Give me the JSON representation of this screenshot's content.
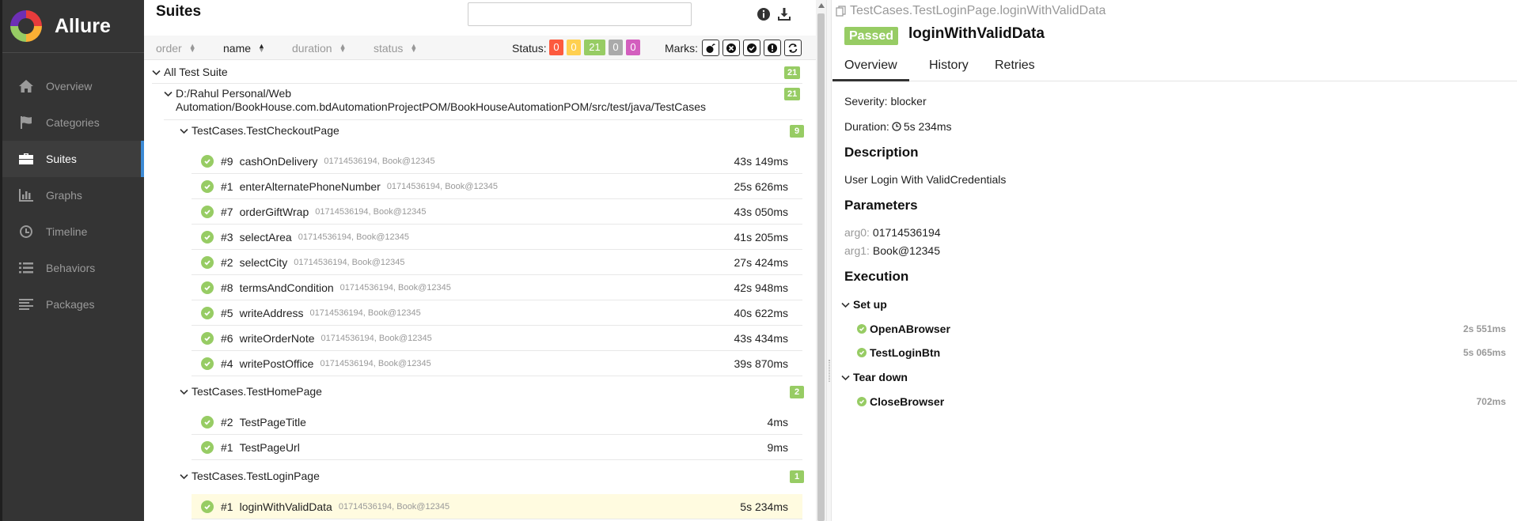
{
  "brand": {
    "name": "Allure"
  },
  "sidebar": {
    "items": [
      {
        "label": "Overview",
        "icon": "home-icon"
      },
      {
        "label": "Categories",
        "icon": "flag-icon"
      },
      {
        "label": "Suites",
        "icon": "briefcase-icon",
        "active": true
      },
      {
        "label": "Graphs",
        "icon": "bar-chart-icon"
      },
      {
        "label": "Timeline",
        "icon": "clock-icon"
      },
      {
        "label": "Behaviors",
        "icon": "list-icon"
      },
      {
        "label": "Packages",
        "icon": "align-left-icon"
      }
    ]
  },
  "suites": {
    "title": "Suites",
    "search_placeholder": "",
    "sort": {
      "order": "order",
      "name": "name",
      "duration": "duration",
      "status": "status"
    },
    "status_label": "Status:",
    "status_counts": [
      {
        "value": "0",
        "color": "#fd5a3e"
      },
      {
        "value": "0",
        "color": "#ffd050"
      },
      {
        "value": "21",
        "color": "#97cc64"
      },
      {
        "value": "0",
        "color": "#aaaaaa"
      },
      {
        "value": "0",
        "color": "#d35ebe"
      }
    ],
    "marks_label": "Marks:",
    "root": {
      "label": "All Test Suite",
      "count": "21"
    },
    "path": {
      "line1": "D:/Rahul Personal/Web",
      "line2": "Automation/BookHouse.com.bdAutomationProjectPOM/BookHouseAutomationPOM/src/test/java/TestCases",
      "count": "21"
    },
    "groups": [
      {
        "name": "TestCases.TestCheckoutPage",
        "count": "9",
        "rows": [
          {
            "num": "#9",
            "name": "cashOnDelivery",
            "params": "01714536194, Book@12345",
            "dur": "43s 149ms"
          },
          {
            "num": "#1",
            "name": "enterAlternatePhoneNumber",
            "params": "01714536194, Book@12345",
            "dur": "25s 626ms"
          },
          {
            "num": "#7",
            "name": "orderGiftWrap",
            "params": "01714536194, Book@12345",
            "dur": "43s 050ms"
          },
          {
            "num": "#3",
            "name": "selectArea",
            "params": "01714536194, Book@12345",
            "dur": "41s 205ms"
          },
          {
            "num": "#2",
            "name": "selectCity",
            "params": "01714536194, Book@12345",
            "dur": "27s 424ms"
          },
          {
            "num": "#8",
            "name": "termsAndCondition",
            "params": "01714536194, Book@12345",
            "dur": "42s 948ms"
          },
          {
            "num": "#5",
            "name": "writeAddress",
            "params": "01714536194, Book@12345",
            "dur": "40s 622ms"
          },
          {
            "num": "#6",
            "name": "writeOrderNote",
            "params": "01714536194, Book@12345",
            "dur": "43s 434ms"
          },
          {
            "num": "#4",
            "name": "writePostOffice",
            "params": "01714536194, Book@12345",
            "dur": "39s 870ms"
          }
        ]
      },
      {
        "name": "TestCases.TestHomePage",
        "count": "2",
        "rows": [
          {
            "num": "#2",
            "name": "TestPageTitle",
            "params": "",
            "dur": "4ms"
          },
          {
            "num": "#1",
            "name": "TestPageUrl",
            "params": "",
            "dur": "9ms"
          }
        ]
      },
      {
        "name": "TestCases.TestLoginPage",
        "count": "1",
        "rows": [
          {
            "num": "#1",
            "name": "loginWithValidData",
            "params": "01714536194, Book@12345",
            "dur": "5s 234ms"
          }
        ]
      }
    ]
  },
  "detail": {
    "breadcrumb": "TestCases.TestLoginPage.loginWithValidData",
    "status": "Passed",
    "status_color": "#97cc64",
    "title": "loginWithValidData",
    "tabs": [
      "Overview",
      "History",
      "Retries"
    ],
    "severity_label": "Severity:",
    "severity": "blocker",
    "duration_label": "Duration:",
    "duration": "5s 234ms",
    "description_heading": "Description",
    "description": "User Login With ValidCredentials",
    "parameters_heading": "Parameters",
    "params": [
      {
        "key": "arg0",
        "value": "01714536194"
      },
      {
        "key": "arg1",
        "value": "Book@12345"
      }
    ],
    "execution_heading": "Execution",
    "setup_label": "Set up",
    "setup_steps": [
      {
        "name": "OpenABrowser",
        "dur": "2s 551ms"
      },
      {
        "name": "TestLoginBtn",
        "dur": "5s 065ms"
      }
    ],
    "teardown_label": "Tear down",
    "teardown_steps": [
      {
        "name": "CloseBrowser",
        "dur": "702ms"
      }
    ]
  }
}
